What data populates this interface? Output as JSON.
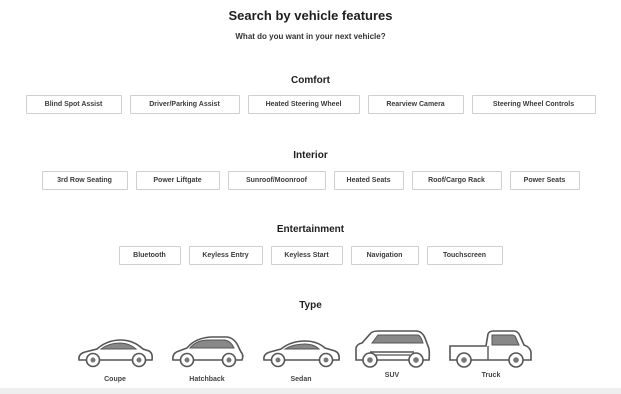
{
  "header": {
    "title": "Search by vehicle features",
    "subtitle": "What do you want in your next vehicle?"
  },
  "comfort": {
    "title": "Comfort",
    "items": [
      "Blind Spot Assist",
      "Driver/Parking Assist",
      "Heated Steering Wheel",
      "Rearview Camera",
      "Steering Wheel Controls"
    ]
  },
  "interior": {
    "title": "Interior",
    "items": [
      "3rd Row Seating",
      "Power Liftgate",
      "Sunroof/Moonroof",
      "Heated Seats",
      "Roof/Cargo Rack",
      "Power Seats"
    ]
  },
  "entertainment": {
    "title": "Entertainment",
    "items": [
      "Bluetooth",
      "Keyless Entry",
      "Keyless Start",
      "Navigation",
      "Touchscreen"
    ]
  },
  "type": {
    "title": "Type",
    "items": [
      {
        "label": "Coupe",
        "icon": "coupe-icon"
      },
      {
        "label": "Hatchback",
        "icon": "hatchback-icon"
      },
      {
        "label": "Sedan",
        "icon": "sedan-icon"
      },
      {
        "label": "SUV",
        "icon": "suv-icon"
      },
      {
        "label": "Truck",
        "icon": "truck-icon"
      }
    ]
  }
}
